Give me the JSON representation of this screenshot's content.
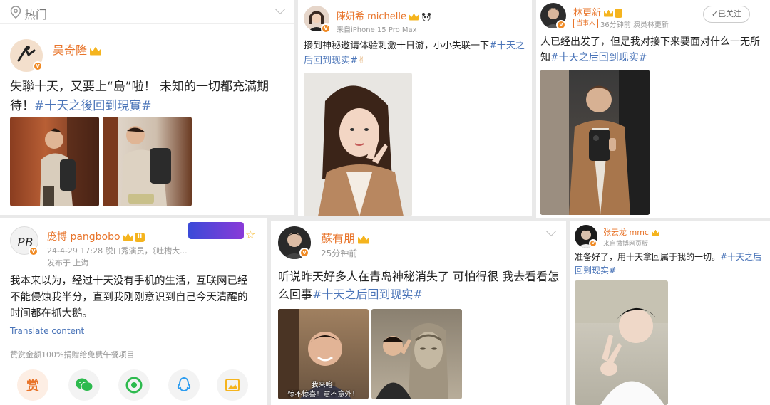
{
  "top_bar": {
    "label": "热门"
  },
  "p1": {
    "name": "吴奇隆",
    "text": "失聯十天，又要上“島”啦！ 未知的一切都充滿期待！",
    "hashtag": "#十天之後回到現實#"
  },
  "p2": {
    "name": "陳妍希 michelle",
    "source": "来自iPhone 15 Pro Max",
    "text": "接到神秘邀请体验刺激十日游，小小失联一下",
    "hashtag": "#十天之后回到现实#",
    "emoji": "✌"
  },
  "p3": {
    "name": "林更新",
    "tag": "当事人",
    "meta": "36分钟前  演员林更新",
    "follow_label": "已关注",
    "text": "人已经出发了，但是我对接下来要面对什么一无所知",
    "hashtag": "#十天之后回到现实#"
  },
  "p4": {
    "name": "庞博 pangbobo",
    "level": "II",
    "meta_line1": "24-4-29 17:28  脱口秀演员，《吐槽大...",
    "meta_line2": "发布于 上海",
    "text": "我本来以为，经过十天没有手机的生活，互联网已经不能侵蚀我半分，直到我刚刚意识到自己今天清醒的时间都在抓大鹅。",
    "translate": "Translate content",
    "charity": "赞赏金额100%捐赠给免费午餐项目",
    "reward_label": "赏"
  },
  "p5": {
    "name": "蘇有朋",
    "meta": "25分钟前",
    "text": "听说昨天好多人在青岛神秘消失了 可怕得很 我去看看怎么回事",
    "hashtag": "#十天之后回到现实#",
    "caption1": "我来咯!",
    "caption2": "惊不惊喜！意不意外！"
  },
  "p6": {
    "name": "张云龙 mmc",
    "source": "来自微博网页版",
    "text": "准备好了，用十天拿回属于我的一切。",
    "hashtag": "#十天之后回到现实#"
  },
  "colors": {
    "username": "#e8742a",
    "hashtag": "#4a74b8",
    "verified": "#f08a24",
    "gold": "#f5b41e"
  }
}
